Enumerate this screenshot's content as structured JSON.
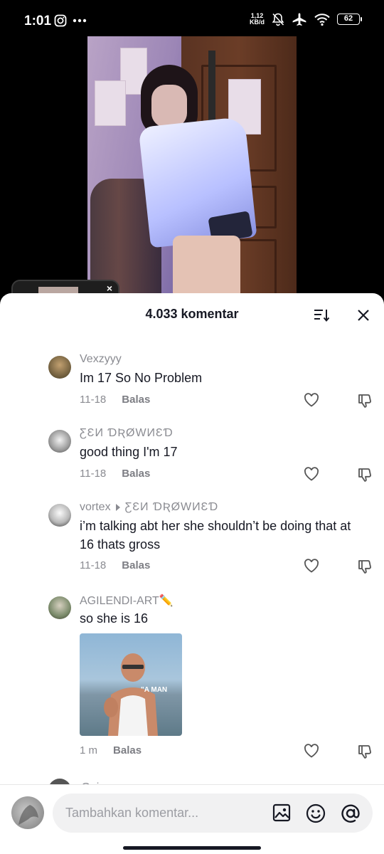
{
  "status_bar": {
    "time": "1:01",
    "left_icons": [
      "instagram-icon",
      "more-dots-icon"
    ],
    "netspeed_value": "1,12",
    "netspeed_unit": "KB/d",
    "right_icons": [
      "bell-off-icon",
      "airplane-icon",
      "wifi-icon"
    ],
    "battery": "62"
  },
  "comments_panel": {
    "title": "4.033 komentar",
    "sort_icon": "sort-icon",
    "close_icon": "close-icon"
  },
  "comments": [
    {
      "user": "Vexzyyy",
      "text": "Im 17 So No Problem",
      "date": "11-18",
      "reply": "Balas"
    },
    {
      "user": "ƸƐИ ƊƦØWИƐƊ",
      "text": "good thing I'm 17",
      "date": "11-18",
      "reply": "Balas"
    },
    {
      "user": "vortex",
      "reply_to": "ƸƐИ ƊƦØWИƐƊ",
      "text": "i’m talking abt her she shouldn’t be doing that at 16 thats gross",
      "date": "11-18",
      "reply": "Balas"
    },
    {
      "user": "AGILENDI-ART✏️",
      "text": "so she is 16",
      "gif_caption": "\"A MAN",
      "date": "1 m",
      "reply": "Balas"
    }
  ],
  "next_comment_peek": "Gaisss",
  "input": {
    "placeholder": "Tambahkan komentar...",
    "icons": [
      "image-icon",
      "emoji-icon",
      "mention-icon"
    ]
  },
  "colors": {
    "text_primary": "#161823",
    "text_secondary": "#8a8b91",
    "input_bg": "#f1f1f2"
  }
}
